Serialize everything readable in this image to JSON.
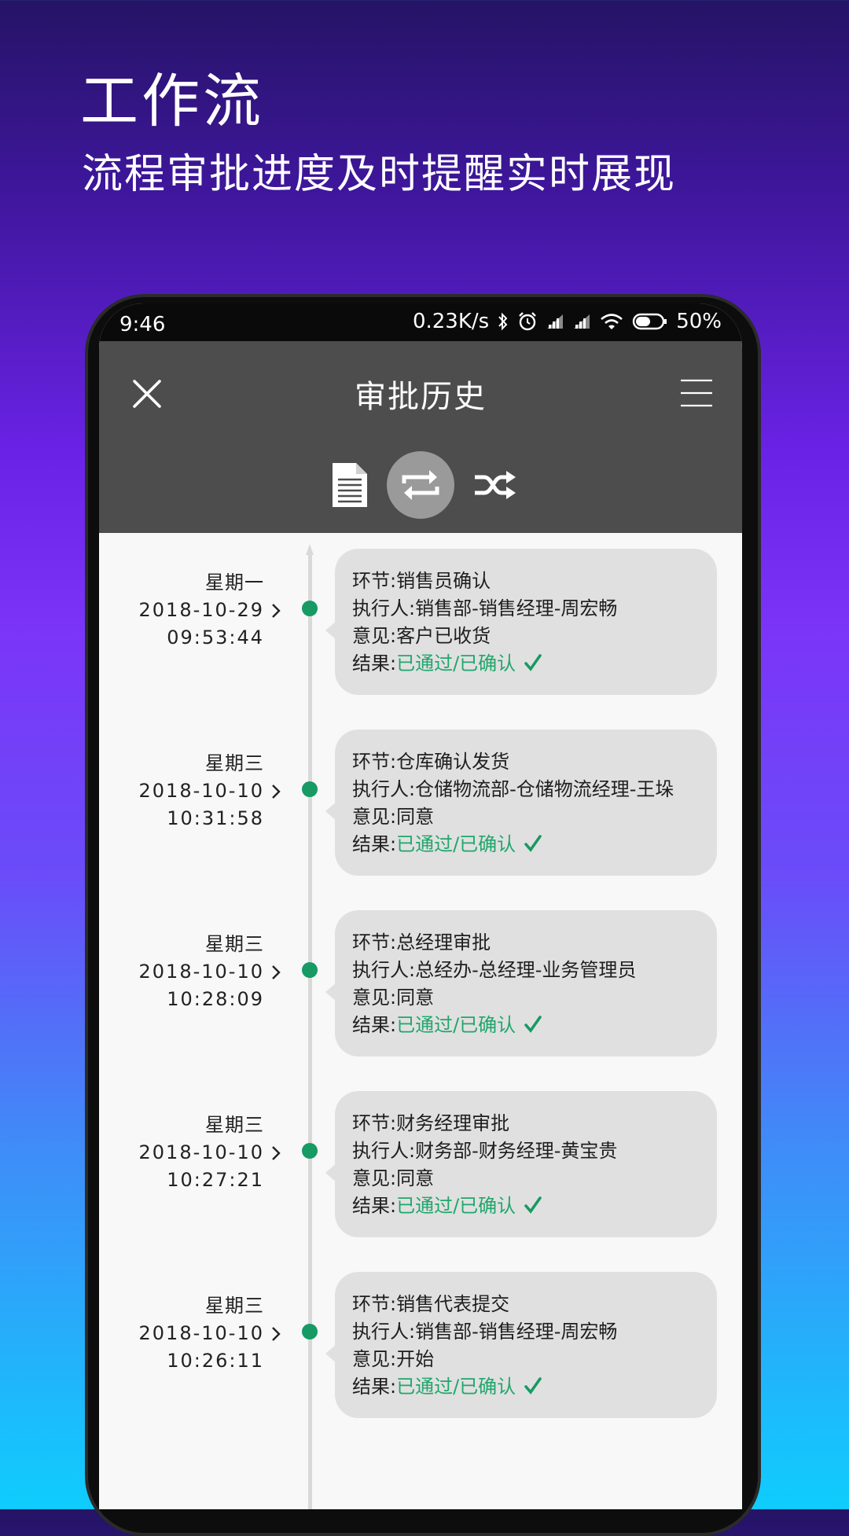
{
  "promo": {
    "headline": "工作流",
    "subline": "流程审批进度及时提醒实时展现"
  },
  "statusbar": {
    "time": "9:46",
    "speed": "0.23K/s",
    "battery": "50%",
    "icons": [
      "bluetooth-icon",
      "alarm-icon",
      "signal-icon",
      "signal-icon",
      "wifi-icon",
      "battery-icon"
    ]
  },
  "appbar": {
    "title": "审批历史",
    "left_icon": "close-icon",
    "right_icon": "menu-icon"
  },
  "tabs": [
    {
      "icon": "document-icon",
      "active": false
    },
    {
      "icon": "repeat-icon",
      "active": true
    },
    {
      "icon": "shuffle-icon",
      "active": false
    }
  ],
  "timeline": [
    {
      "weekday": "星期一",
      "date": "2018-10-29",
      "time": "09:53:44",
      "step": "环节:销售员确认",
      "executor": "执行人:销售部-销售经理-周宏畅",
      "opinion": "意见:客户已收货",
      "result_label": "结果:",
      "result_value": "已通过/已确认"
    },
    {
      "weekday": "星期三",
      "date": "2018-10-10",
      "time": "10:31:58",
      "step": "环节:仓库确认发货",
      "executor": "执行人:仓储物流部-仓储物流经理-王垛",
      "opinion": "意见:同意",
      "result_label": "结果:",
      "result_value": "已通过/已确认"
    },
    {
      "weekday": "星期三",
      "date": "2018-10-10",
      "time": "10:28:09",
      "step": "环节:总经理审批",
      "executor": "执行人:总经办-总经理-业务管理员",
      "opinion": "意见:同意",
      "result_label": "结果:",
      "result_value": "已通过/已确认"
    },
    {
      "weekday": "星期三",
      "date": "2018-10-10",
      "time": "10:27:21",
      "step": "环节:财务经理审批",
      "executor": "执行人:财务部-财务经理-黄宝贵",
      "opinion": "意见:同意",
      "result_label": "结果:",
      "result_value": "已通过/已确认"
    },
    {
      "weekday": "星期三",
      "date": "2018-10-10",
      "time": "10:26:11",
      "step": "环节:销售代表提交",
      "executor": "执行人:销售部-销售经理-周宏畅",
      "opinion": "意见:开始",
      "result_label": "结果:",
      "result_value": "已通过/已确认"
    }
  ],
  "colors": {
    "appbar": "#4d4d4d",
    "dot": "#179a63",
    "result": "#21a66c",
    "bubble": "#e0e0e0"
  }
}
